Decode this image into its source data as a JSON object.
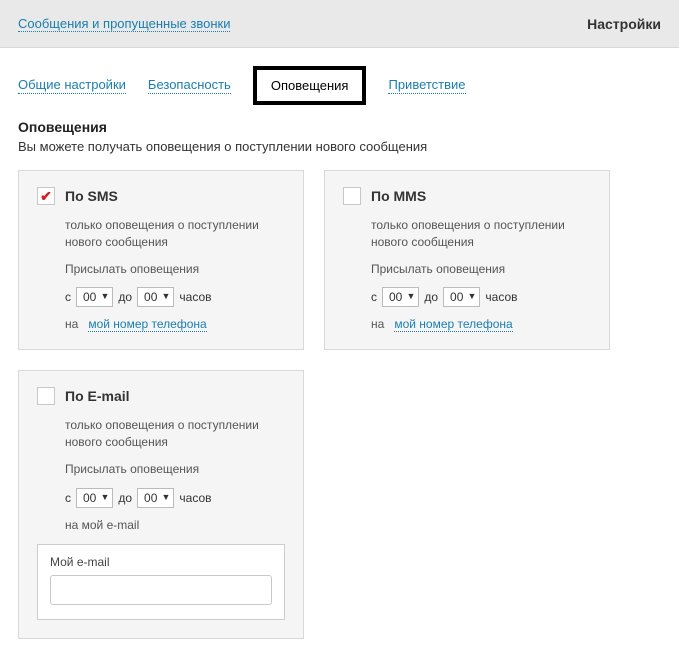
{
  "header": {
    "breadcrumb": "Сообщения и пропущенные звонки",
    "title": "Настройки"
  },
  "tabs": {
    "general": "Общие настройки",
    "security": "Безопасность",
    "notifications": "Оповещения",
    "greeting": "Приветствие"
  },
  "section": {
    "title": "Оповещения",
    "desc": "Вы можете получать оповещения о поступлении нового сообщения"
  },
  "common": {
    "sub": "только оповещения о поступлении нового сообщения",
    "send_label": "Присылать оповещения",
    "from": "с",
    "to": "до",
    "hours": "часов",
    "time_from": "00",
    "time_to": "00",
    "on_prefix": "на",
    "phone_link": "мой номер телефона"
  },
  "sms": {
    "title": "По SMS"
  },
  "mms": {
    "title": "По MMS"
  },
  "email": {
    "title": "По E-mail",
    "on_text": "на мой e-mail",
    "input_label": "Мой e-mail",
    "input_value": ""
  }
}
